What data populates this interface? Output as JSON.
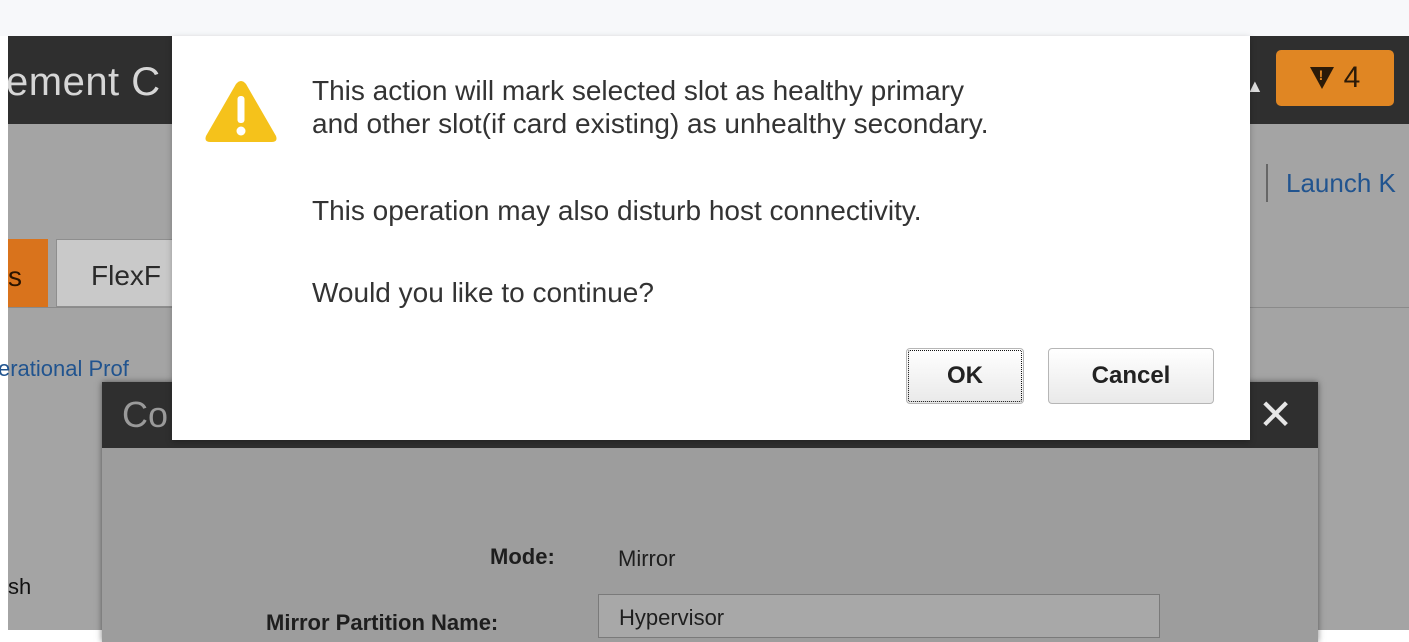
{
  "app": {
    "title_fragment": "ement C",
    "header_glyph": "▲",
    "alert_count": "4",
    "alert_color": "#e08623",
    "launch_link": "Launch K"
  },
  "tabs": [
    {
      "label": "s",
      "active": true
    },
    {
      "label": "FlexF",
      "active": false
    }
  ],
  "operational_link": "erational Prof",
  "background_text": "sh",
  "inner_dialog": {
    "title": "Co",
    "close_icon": "✕",
    "fields": {
      "mode_label": "Mode:",
      "mode_value": "Mirror",
      "partition_label": "Mirror Partition Name:",
      "partition_value": "Hypervisor"
    }
  },
  "confirm_dialog": {
    "icon": "warning-icon",
    "icon_color": "#f5c21b",
    "message_line1": "This action will mark selected slot as healthy primary",
    "message_line2": "and other slot(if card existing) as unhealthy secondary.",
    "message_line3": "This operation may also disturb host connectivity.",
    "message_line4": "Would you like to continue?",
    "ok_label": "OK",
    "cancel_label": "Cancel"
  }
}
